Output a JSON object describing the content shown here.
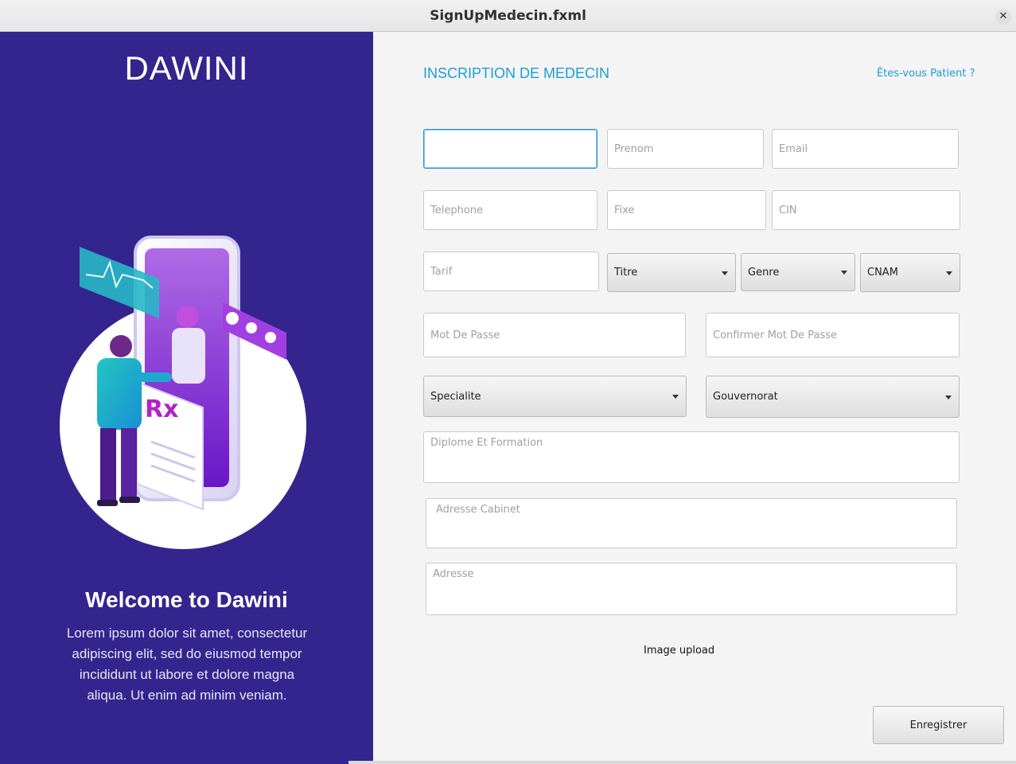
{
  "window": {
    "title": "SignUpMedecin.fxml",
    "close": "✕"
  },
  "left_panel": {
    "brand": "DAWINI",
    "welcome": "Welcome to Dawini",
    "lorem_lines": [
      "Lorem ipsum dolor sit amet, consectetur",
      "adipiscing elit, sed do eiusmod tempor",
      "incididunt ut labore et dolore magna",
      "aliqua. Ut enim ad minim veniam."
    ],
    "bg_color": "#33258d"
  },
  "form": {
    "heading": "INSCRIPTION DE MEDECIN",
    "patient_link": "Êtes-vous Patient ?",
    "nom_value": "",
    "placeholders": {
      "prenom": "Prenom",
      "email": "Email",
      "telephone": "Telephone",
      "fixe": "Fixe",
      "cin": "CIN",
      "tarif": "Tarif",
      "mot_de_passe": "Mot De Passe",
      "confirmer": "Confirmer Mot De Passe",
      "diplome": "Diplome Et Formation",
      "adresse_cabinet": "Adresse Cabinet",
      "adresse": "Adresse"
    },
    "combos": {
      "titre": "Titre",
      "genre": "Genre",
      "cnam": "CNAM",
      "specialite": "Specialite",
      "gouvernorat": "Gouvernorat"
    },
    "image_upload": "Image upload",
    "submit": "Enregistrer",
    "accent_color": "#1a9ed6"
  }
}
